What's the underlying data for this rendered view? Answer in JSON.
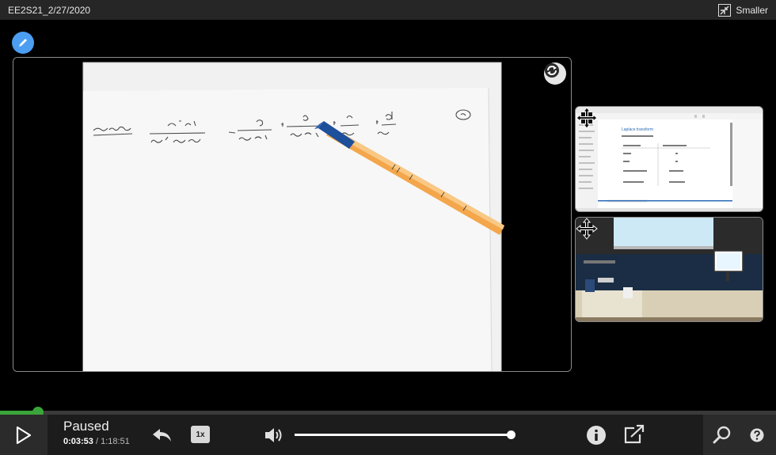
{
  "window": {
    "title": "EE2S21_2/27/2020",
    "smaller_label": "Smaller"
  },
  "player": {
    "state": "Paused",
    "current_time": "0:03:53",
    "separator": " / ",
    "duration": "1:18:51",
    "speed_label": "1x",
    "progress_fraction": 0.049,
    "volume_fraction": 0.99
  },
  "slide_thumb": {
    "heading": "Laplace transform"
  },
  "colors": {
    "accent_green": "#3aa53a",
    "pencil_blue": "#4b9ef2",
    "control_bar": "#1c1c1c",
    "title_bar": "#262626"
  },
  "icons": {
    "pencil": "pencil-icon",
    "swap": "swap-streams-icon",
    "move": "move-icon",
    "play": "play-icon",
    "rewind": "rewind-icon",
    "volume": "volume-icon",
    "info": "info-icon",
    "popout": "popout-icon",
    "search": "search-icon",
    "help": "help-icon",
    "smaller": "shrink-icon"
  }
}
